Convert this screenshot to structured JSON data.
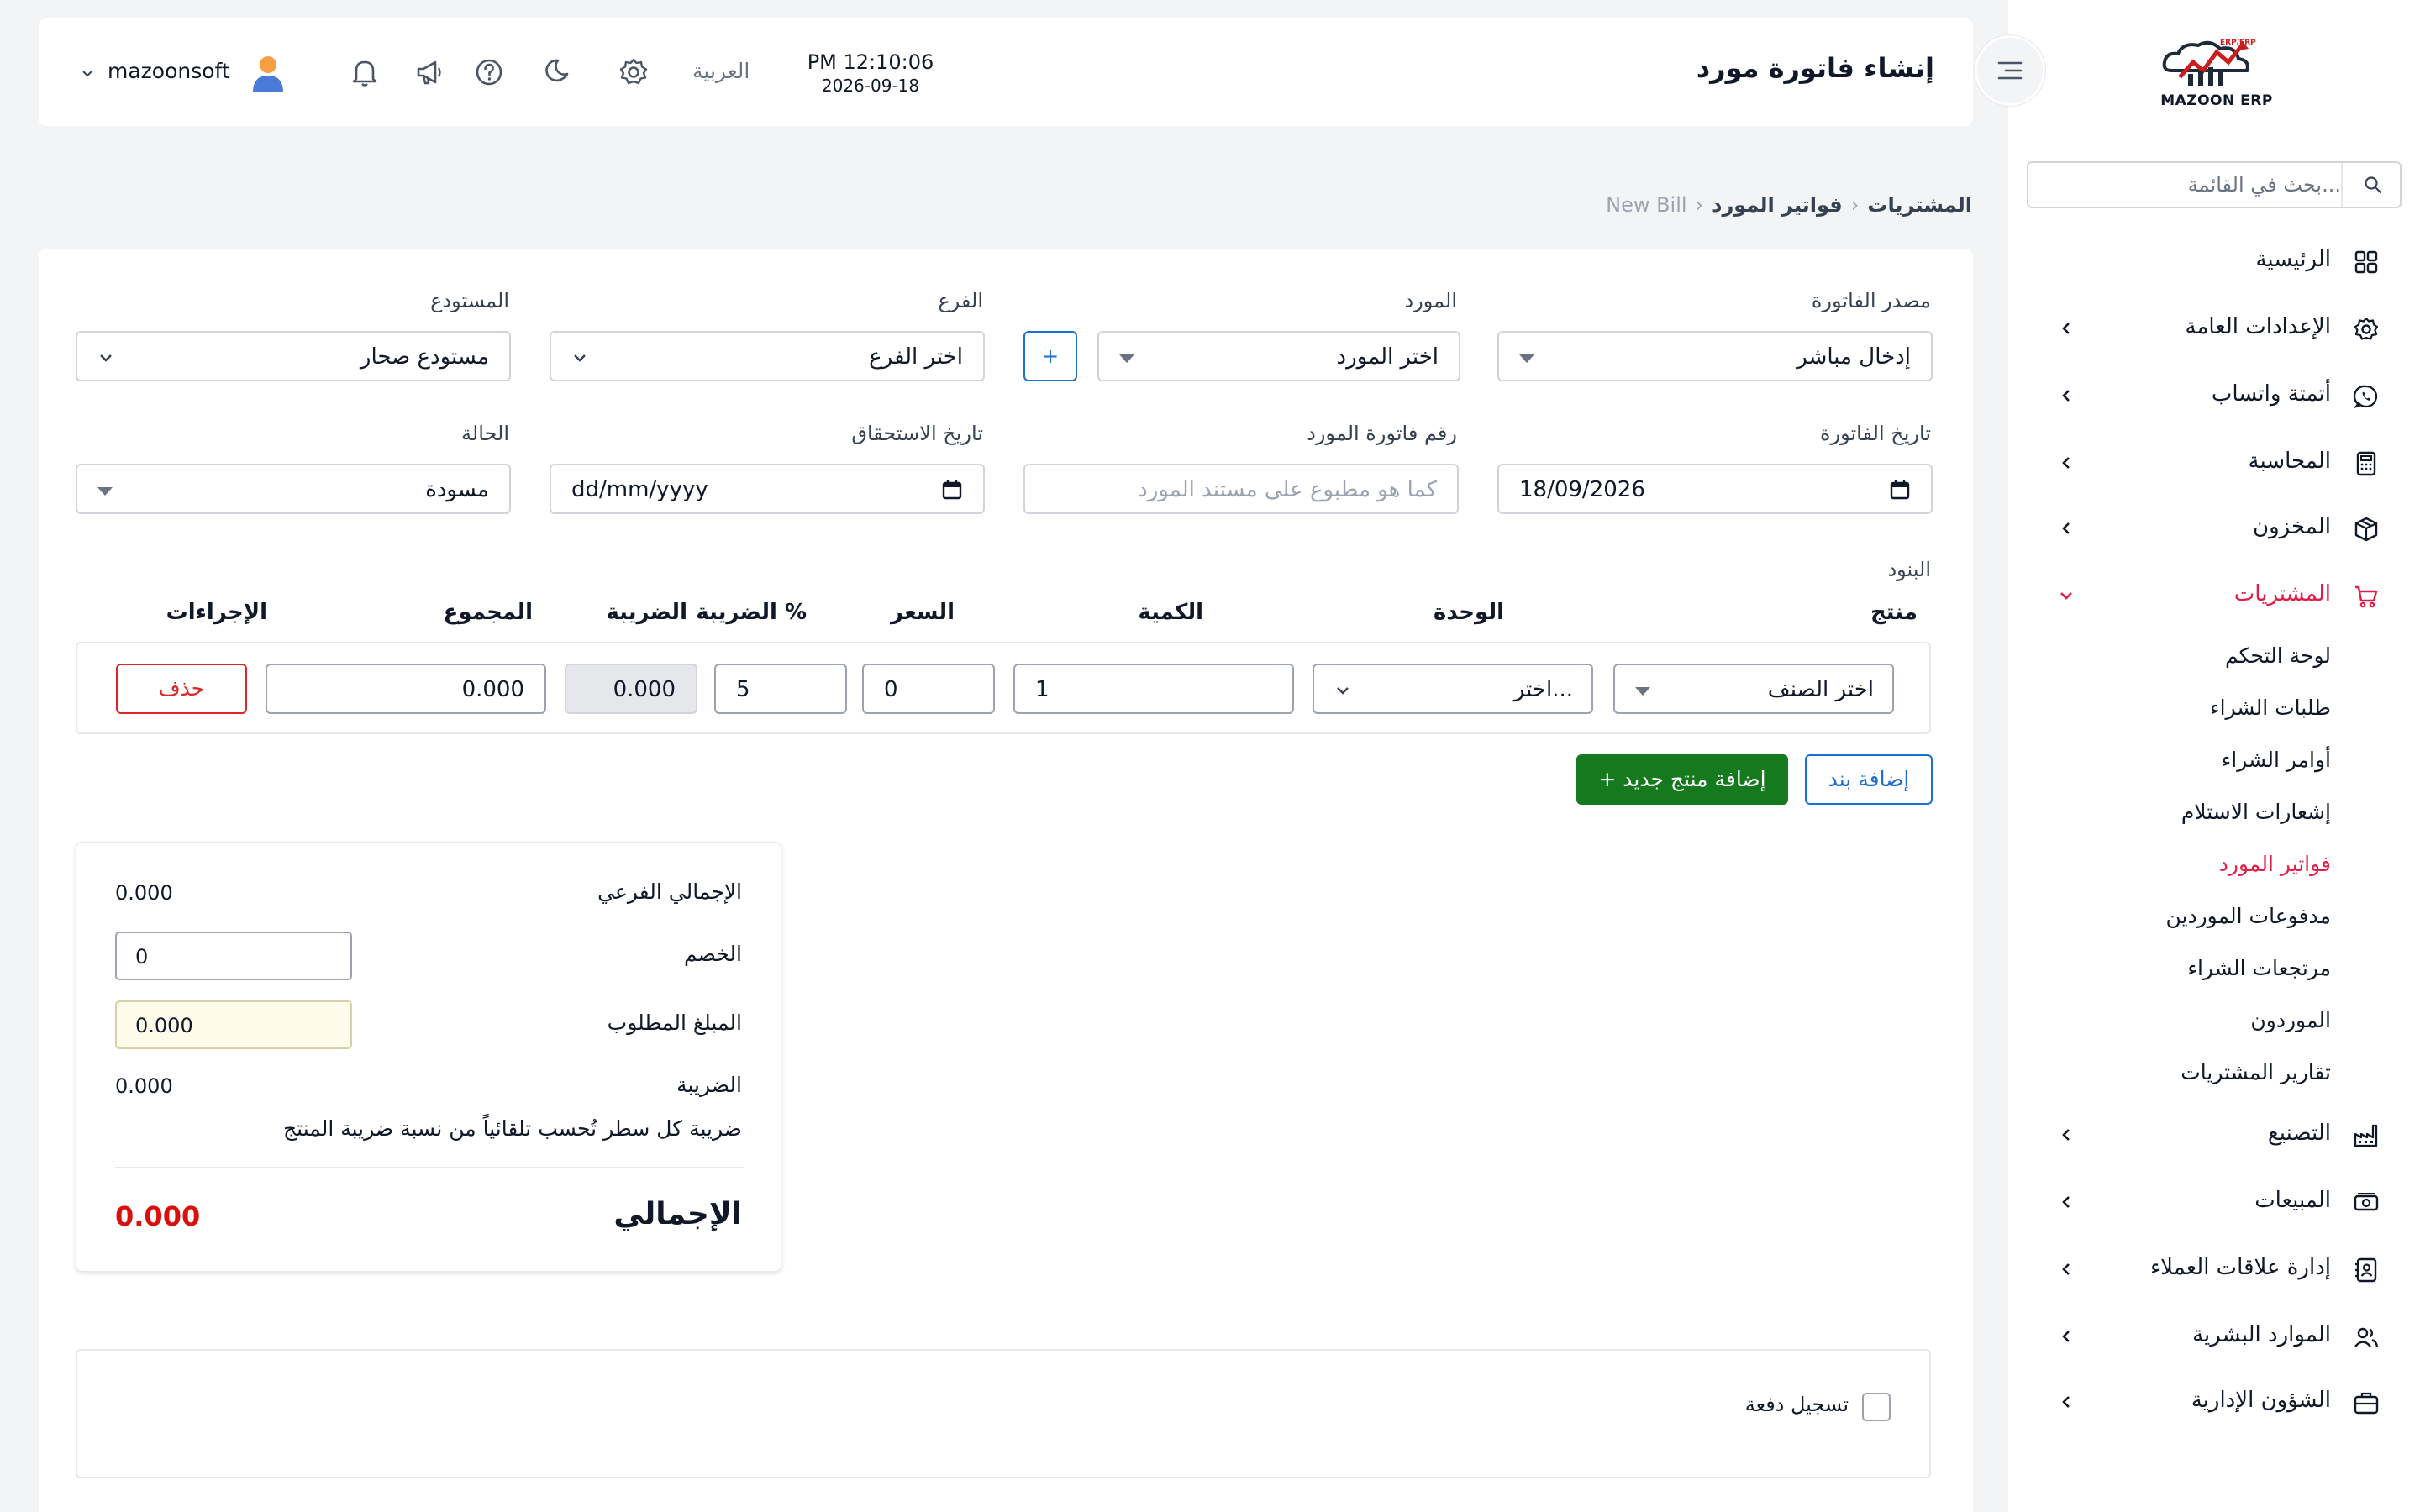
{
  "brand": {
    "name": "MAZOON ERP",
    "tagline": "ERP/ERP"
  },
  "sidebar": {
    "search_placeholder": "بحث في القائمة...",
    "items": [
      {
        "label": "الرئيسية",
        "icon": "grid-icon"
      },
      {
        "label": "الإعدادات العامة",
        "icon": "gear-icon"
      },
      {
        "label": "أتمتة واتساب",
        "icon": "whatsapp-icon"
      },
      {
        "label": "المحاسبة",
        "icon": "calculator-icon"
      },
      {
        "label": "المخزون",
        "icon": "box-icon"
      },
      {
        "label": "المشتريات",
        "icon": "cart-icon"
      },
      {
        "label": "التصنيع",
        "icon": "factory-icon"
      },
      {
        "label": "المبيعات",
        "icon": "cash-icon"
      },
      {
        "label": "إدارة علاقات العملاء",
        "icon": "contacts-icon"
      },
      {
        "label": "الموارد البشرية",
        "icon": "users-icon"
      },
      {
        "label": "الشؤون الإدارية",
        "icon": "briefcase-icon"
      }
    ],
    "purchases_sub": [
      "لوحة التحكم",
      "طلبات الشراء",
      "أوامر الشراء",
      "إشعارات الاستلام",
      "فواتير المورد",
      "مدفوعات الموردين",
      "مرتجعات الشراء",
      "الموردون",
      "تقارير المشتريات"
    ]
  },
  "header": {
    "title": "إنشاء فاتورة مورد",
    "time": "PM 12:10:06",
    "date": "2026-09-18",
    "language": "العربية",
    "username": "mazoonsoft"
  },
  "breadcrumb": {
    "root": "المشتريات",
    "section": "فواتير المورد",
    "current": "New Bill"
  },
  "form": {
    "source_label": "مصدر الفاتورة",
    "source_value": "إدخال مباشر",
    "supplier_label": "المورد",
    "supplier_value": "اختر المورد",
    "add_supplier": "+",
    "branch_label": "الفرع",
    "branch_value": "اختر الفرع",
    "warehouse_label": "المستودع",
    "warehouse_value": "مستودع صحار",
    "bill_date_label": "تاريخ الفاتورة",
    "bill_date_value": "18/09/2026",
    "supplier_bill_no_label": "رقم فاتورة المورد",
    "supplier_bill_no_placeholder": "كما هو مطبوع على مستند المورد",
    "due_date_label": "تاريخ الاستحقاق",
    "due_date_value": "dd/mm/yyyy",
    "status_label": "الحالة",
    "status_value": "مسودة"
  },
  "items": {
    "section_label": "البنود",
    "headers": {
      "product": "منتج",
      "unit": "الوحدة",
      "qty": "الكمية",
      "price": "السعر",
      "tax_pct": "الضريبة %",
      "tax": "الضريبة",
      "total": "المجموع",
      "actions": "الإجراءات"
    },
    "row": {
      "product": "اختر الصنف",
      "unit": "اختر...",
      "qty": "1",
      "price": "0",
      "tax_pct": "5",
      "tax": "0.000",
      "total": "0.000",
      "delete": "حذف"
    },
    "add_line": "إضافة بند",
    "add_product": "+ إضافة منتج جديد"
  },
  "totals": {
    "subtotal_label": "الإجمالي الفرعي",
    "subtotal_value": "0.000",
    "discount_label": "الخصم",
    "discount_value": "0",
    "amount_due_label": "المبلغ المطلوب",
    "amount_due_value": "0.000",
    "tax_label": "الضريبة",
    "tax_value": "0.000",
    "tax_note": "ضريبة كل سطر تُحسب تلقائياً من نسبة ضريبة المنتج",
    "grand_label": "الإجمالي",
    "grand_value": "0.000"
  },
  "payment": {
    "record_label": "تسجيل دفعة"
  },
  "colors": {
    "accent_red": "#e11d48",
    "blue": "#1d6fd1",
    "green": "#157a1e",
    "total_red": "#dc0f0f"
  }
}
